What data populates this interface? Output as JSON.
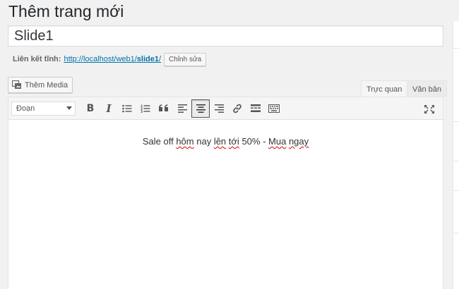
{
  "page": {
    "title": "Thêm trang mới"
  },
  "post": {
    "title_value": "Slide1"
  },
  "permalink": {
    "label": "Liên kết tĩnh:",
    "url_base": "http://localhost/web1/",
    "slug": "slide1",
    "trailing": "/",
    "edit_label": "Chỉnh sửa"
  },
  "media": {
    "add_label": "Thêm Media",
    "icon": "media-icon"
  },
  "tabs": {
    "visual": "Trực quan",
    "text": "Văn bản"
  },
  "toolbar": {
    "format_value": "Đoạn",
    "buttons": [
      "bold",
      "italic",
      "bullet-list",
      "numbered-list",
      "blockquote",
      "align-left",
      "align-center",
      "align-right",
      "link",
      "read-more",
      "toolbar-toggle",
      "fullscreen"
    ],
    "active": "align-center"
  },
  "content": {
    "parts": [
      "Sale off ",
      "hôm",
      " nay ",
      "lên",
      " ",
      "tới",
      " 50% - ",
      "Mua",
      " ",
      "ngay"
    ]
  },
  "colors": {
    "link": "#0073aa",
    "background": "#f1f1f1",
    "spellcheck": "#d00"
  }
}
